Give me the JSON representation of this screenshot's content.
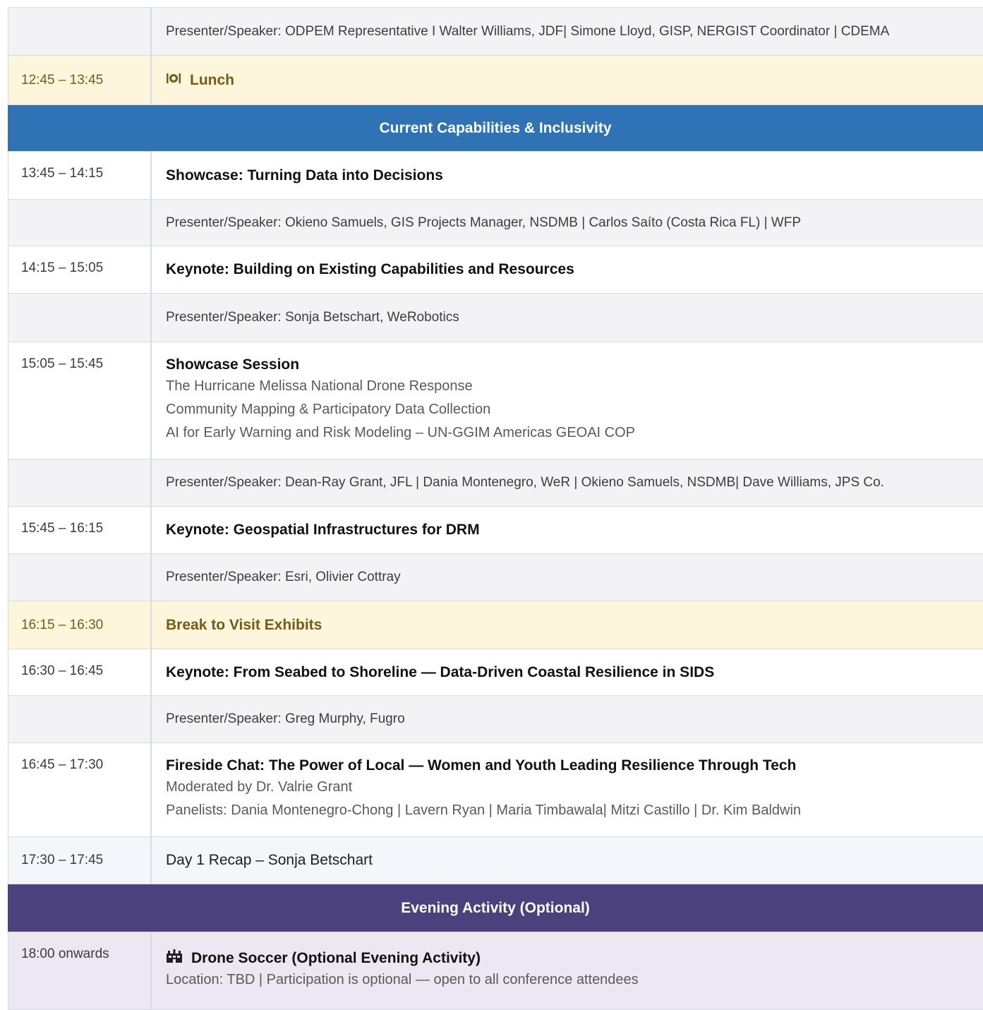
{
  "rows": [
    {
      "kind": "presenter",
      "text": "Presenter/Speaker:  ODPEM Representative  I Walter Williams, JDF| Simone Lloyd, GISP, NERGIST Coordinator | CDEMA"
    },
    {
      "kind": "break",
      "time": "12:45 – 13:45",
      "title": "Lunch",
      "icon": "utensils-icon"
    },
    {
      "kind": "section",
      "title": "Current Capabilities & Inclusivity",
      "color": "#2f73b5"
    },
    {
      "kind": "session",
      "time": "13:45 – 14:15",
      "title": "Showcase:  Turning Data into Decisions"
    },
    {
      "kind": "presenter",
      "text": "Presenter/Speaker:  Okieno Samuels, GIS Projects Manager, NSDMB  | Carlos Saíto (Costa Rica FL) | WFP"
    },
    {
      "kind": "session",
      "time": "14:15 – 15:05",
      "title": "Keynote:  Building on Existing Capabilities and Resources"
    },
    {
      "kind": "presenter",
      "text": "Presenter/Speaker:  Sonja Betschart, WeRobotics"
    },
    {
      "kind": "session",
      "time": "15:05 – 15:45",
      "title": "Showcase Session",
      "lines": [
        "The Hurricane Melissa National Drone Response",
        "Community Mapping & Participatory Data Collection",
        "AI for Early Warning and Risk Modeling – UN-GGIM Americas GEOAI COP"
      ]
    },
    {
      "kind": "presenter",
      "text": "Presenter/Speaker:  Dean-Ray Grant, JFL | Dania Montenegro, WeR | Okieno Samuels, NSDMB|  Dave Williams, JPS Co."
    },
    {
      "kind": "session",
      "time": "15:45 – 16:15",
      "title": "Keynote:  Geospatial Infrastructures for DRM"
    },
    {
      "kind": "presenter",
      "text": "Presenter/Speaker:  Esri, Olivier Cottray"
    },
    {
      "kind": "break",
      "time": "16:15 – 16:30",
      "title": "Break to Visit Exhibits"
    },
    {
      "kind": "session",
      "time": "16:30 – 16:45",
      "title": "Keynote:  From Seabed to Shoreline — Data-Driven Coastal Resilience in SIDS"
    },
    {
      "kind": "presenter",
      "text": "Presenter/Speaker:  Greg Murphy, Fugro"
    },
    {
      "kind": "session",
      "time": "16:45 – 17:30",
      "title": "Fireside Chat:  The Power of Local — Women and Youth Leading Resilience Through Tech",
      "lines": [
        "Moderated by Dr. Valrie Grant",
        "Panelists:  Dania Montenegro-Chong | Lavern Ryan | Maria Timbawala| Mitzi Castillo | Dr. Kim Baldwin"
      ]
    },
    {
      "kind": "recap",
      "time": "17:30 – 17:45",
      "text": "Day 1 Recap – Sonja Betschart"
    },
    {
      "kind": "section",
      "title": "Evening Activity (Optional)",
      "color": "#4a417d"
    },
    {
      "kind": "evening",
      "time": "18:00 onwards",
      "title": "Drone Soccer (Optional Evening Activity)",
      "icon": "stadium-icon",
      "lines": [
        "Location: TBD | Participation is optional — open to all conference attendees"
      ]
    }
  ]
}
